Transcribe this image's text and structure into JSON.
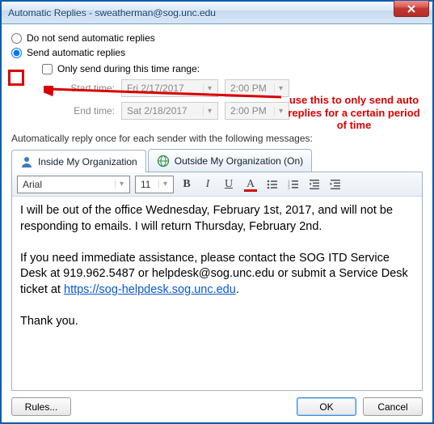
{
  "window": {
    "title": "Automatic Replies - sweatherman@sog.unc.edu"
  },
  "options": {
    "do_not_send_label": "Do not send automatic replies",
    "send_label": "Send automatic replies",
    "only_send_label": "Only send during this time range:",
    "start_label": "Start time:",
    "end_label": "End time:",
    "start_date": "Fri 2/17/2017",
    "start_time": "2:00 PM",
    "end_date": "Sat 2/18/2017",
    "end_time": "2:00 PM"
  },
  "section_label": "Automatically reply once for each sender with the following messages:",
  "tabs": {
    "inside_label": "Inside My Organization",
    "outside_label": "Outside My Organization (On)"
  },
  "toolbar": {
    "font": "Arial",
    "size": "11"
  },
  "message": {
    "p1": "I will be out of the office Wednesday, February 1st, 2017, and will not be responding to emails. I will return Thursday, February 2nd.",
    "p2a": "If you need immediate assistance, please contact the SOG ITD Service Desk at 919.962.5487 or helpdesk@sog.unc.edu or submit a Service Desk ticket at ",
    "p2_link": "https://sog-helpdesk.sog.unc.edu",
    "p2b": ".",
    "p3": "Thank you."
  },
  "buttons": {
    "rules": "Rules...",
    "ok": "OK",
    "cancel": "Cancel"
  },
  "annotation": "use this to only send auto replies for a certain period of time"
}
